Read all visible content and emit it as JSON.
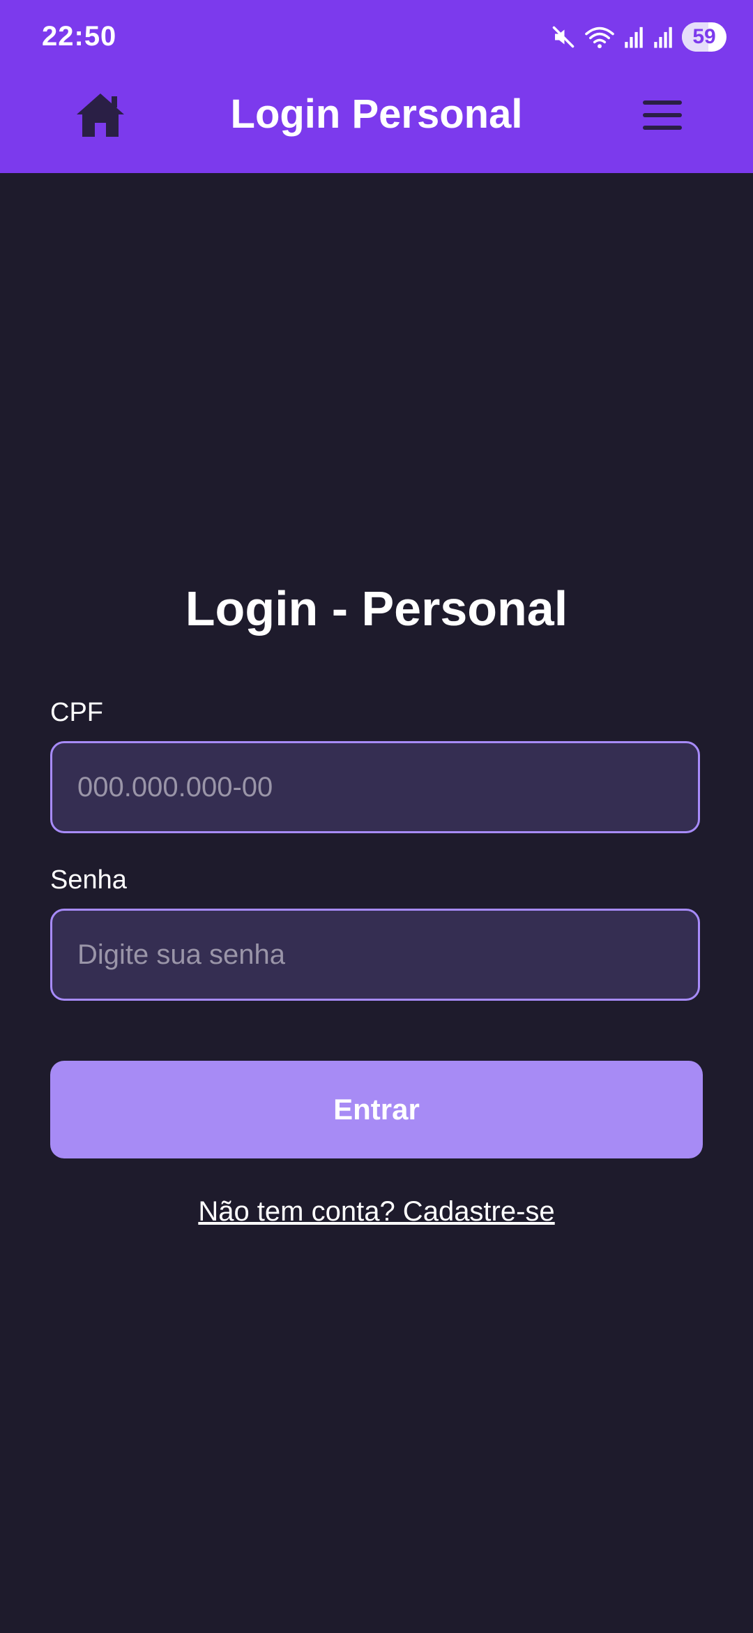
{
  "status_bar": {
    "time": "22:50",
    "battery_level": "59",
    "icons": [
      "mute-icon",
      "wifi-icon",
      "signal-icon",
      "signal-icon"
    ]
  },
  "app_bar": {
    "title": "Login Personal",
    "home_icon": "home-icon",
    "menu_icon": "menu-icon"
  },
  "login": {
    "title": "Login - Personal",
    "cpf_label": "CPF",
    "cpf_placeholder": "000.000.000-00",
    "senha_label": "Senha",
    "senha_placeholder": "Digite sua senha",
    "submit_label": "Entrar",
    "signup_text": "Não tem conta? Cadastre-se"
  },
  "colors": {
    "primary": "#7c3aed",
    "background": "#1e1b2c",
    "input_background": "#352e52",
    "input_border": "#a78bfa",
    "button": "#a78bf5"
  }
}
